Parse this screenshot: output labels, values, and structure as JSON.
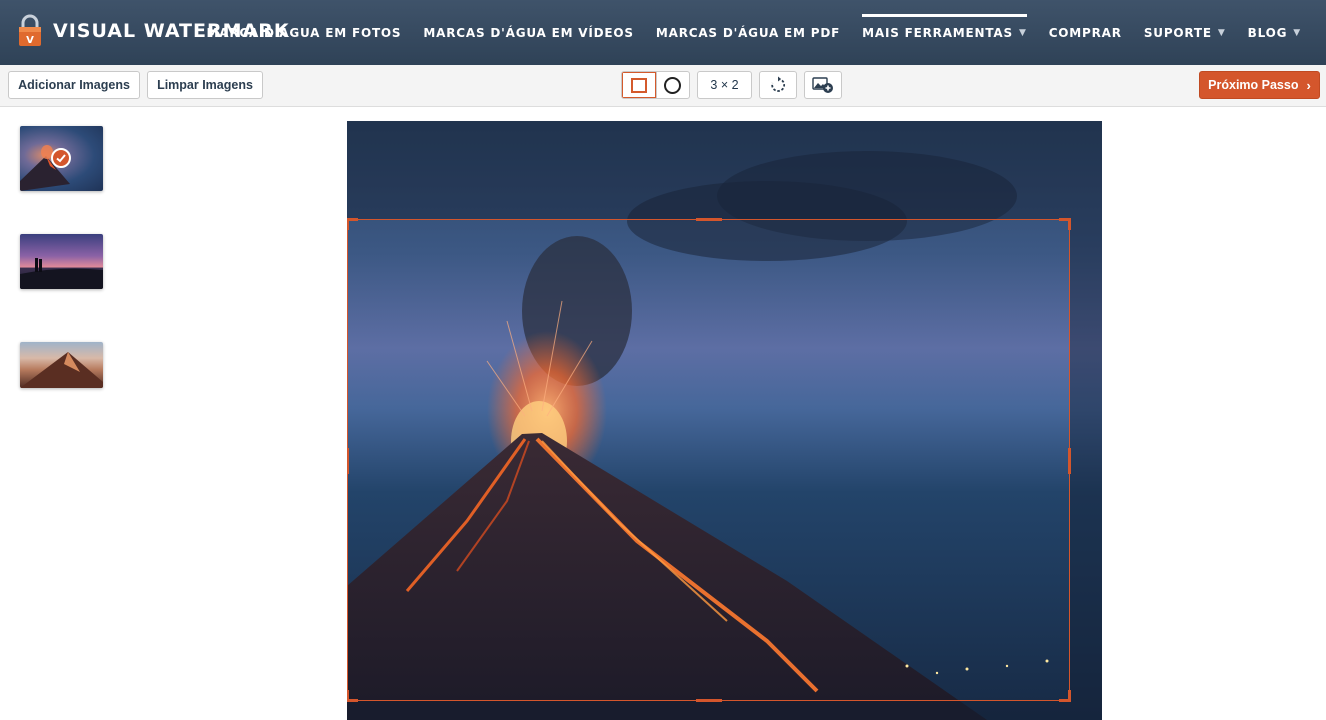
{
  "app": {
    "brand": "VISUAL WATERMARK"
  },
  "nav": {
    "items": [
      {
        "label": "MARCA D'ÁGUA EM FOTOS",
        "caret": ""
      },
      {
        "label": "MARCAS D'ÁGUA EM VÍDEOS",
        "caret": ""
      },
      {
        "label": "MARCAS D'ÁGUA EM PDF",
        "caret": ""
      },
      {
        "label": "MAIS FERRAMENTAS",
        "caret": "▼"
      },
      {
        "label": "COMPRAR",
        "caret": ""
      },
      {
        "label": "SUPORTE",
        "caret": "▼"
      },
      {
        "label": "BLOG",
        "caret": "▼"
      }
    ],
    "active_index": 3
  },
  "toolbar": {
    "add_images_label": "Adicionar Imagens",
    "clear_images_label": "Limpar Imagens",
    "shape_options": [
      "rectangle",
      "circle"
    ],
    "selected_shape": "rectangle",
    "aspect_ratio_label": "3 × 2",
    "rotate_icon": "rotate-icon",
    "add_image_icon": "add-image-icon",
    "next_step_label": "Próximo Passo",
    "next_chevron": "›"
  },
  "sidebar": {
    "thumbnails": [
      {
        "subject": "volcano eruption at dusk",
        "selected": true
      },
      {
        "subject": "couple silhouette at sunset",
        "selected": false
      },
      {
        "subject": "mountain ridge at sunrise",
        "selected": false
      }
    ]
  },
  "colors": {
    "header_bg": "#34485e",
    "accent": "#d4562c",
    "toolbar_bg": "#f4f4f4"
  }
}
